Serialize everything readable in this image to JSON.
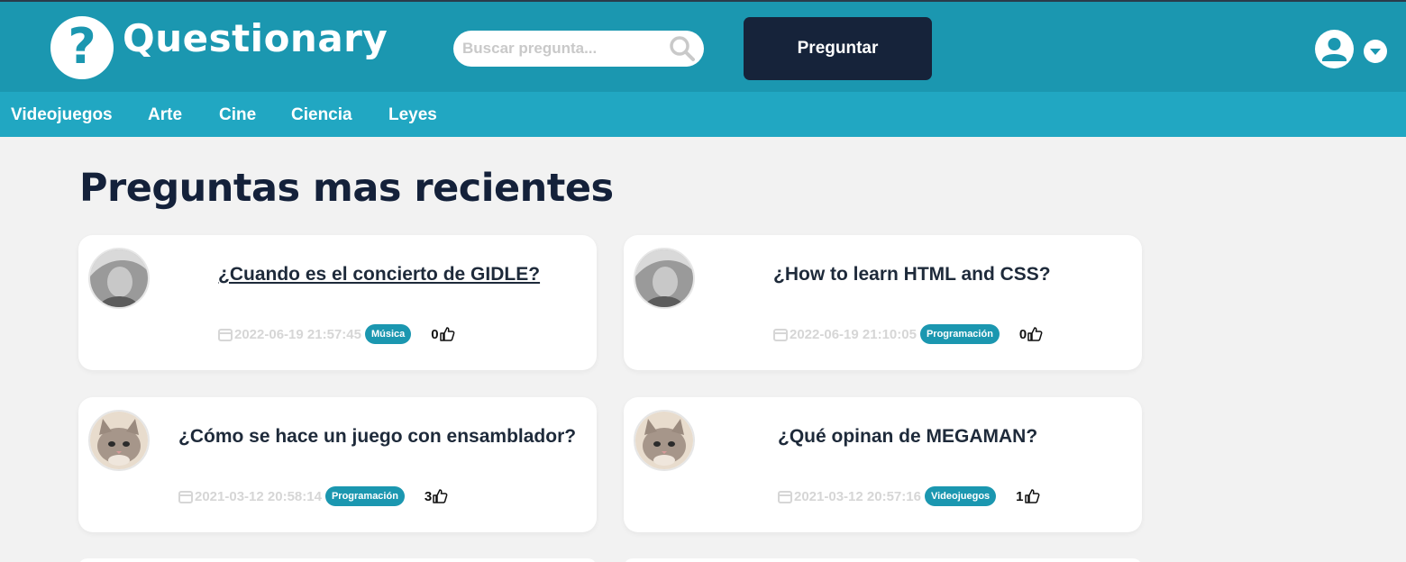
{
  "header": {
    "brand": "Questionary",
    "logo_glyph": "?",
    "search_placeholder": "Buscar pregunta...",
    "ask_button": "Preguntar",
    "colors": {
      "header_bg": "#1b97b0",
      "nav_bg": "#21a7c2",
      "button_bg": "#16233a"
    }
  },
  "categories": [
    "Videojuegos",
    "Arte",
    "Cine",
    "Ciencia",
    "Leyes"
  ],
  "main": {
    "title": "Preguntas mas recientes"
  },
  "questions": [
    {
      "title": "¿Cuando es el concierto de GIDLE?",
      "date": "2022-06-19 21:57:45",
      "tag": "Música",
      "likes": "0",
      "avatar": "girl-avatar"
    },
    {
      "title": "¿How to learn HTML and CSS?",
      "date": "2022-06-19 21:10:05",
      "tag": "Programación",
      "likes": "0",
      "avatar": "girl-avatar"
    },
    {
      "title": "¿Cómo se hace un juego con ensamblador?",
      "date": "2021-03-12 20:58:14",
      "tag": "Programación",
      "likes": "3",
      "avatar": "cat-avatar"
    },
    {
      "title": "¿Qué opinan de MEGAMAN?",
      "date": "2021-03-12 20:57:16",
      "tag": "Videojuegos",
      "likes": "1",
      "avatar": "cat-avatar"
    }
  ]
}
